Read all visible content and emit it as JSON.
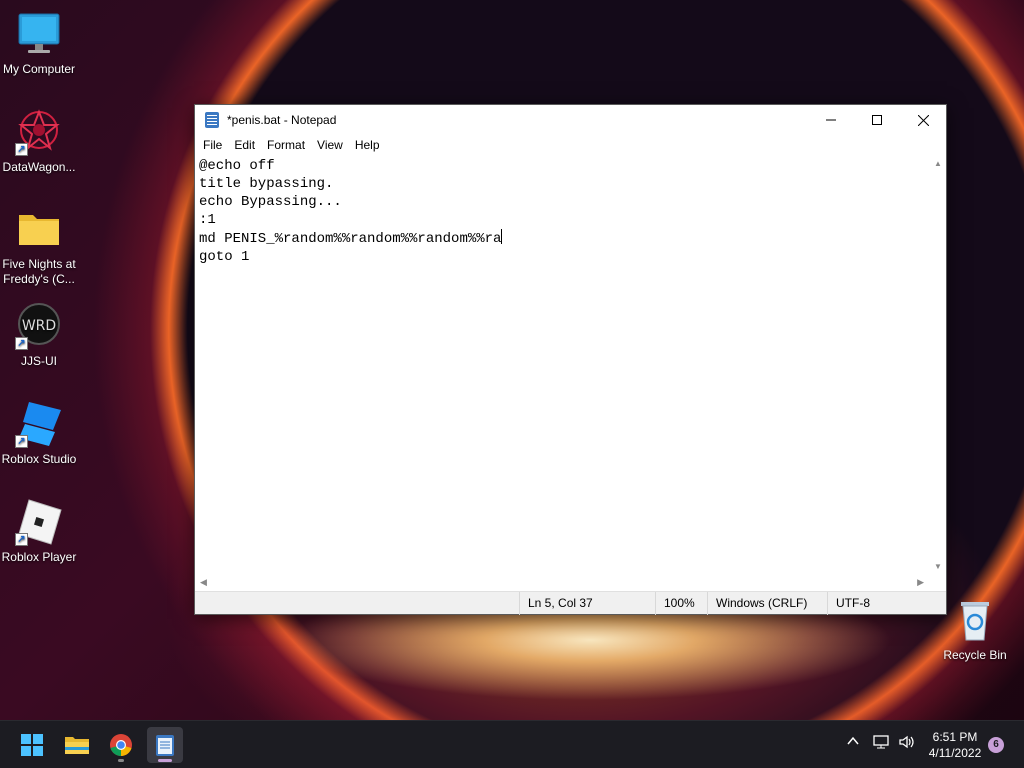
{
  "desktop": {
    "icons": [
      {
        "label": "My Computer"
      },
      {
        "label": "DataWagon..."
      },
      {
        "label": "Five Nights at Freddy's (C..."
      },
      {
        "label": "JJS-UI"
      },
      {
        "label": "Roblox Studio"
      },
      {
        "label": "Roblox Player"
      },
      {
        "label": "Recycle Bin"
      }
    ],
    "icon_logo_text": "WRD"
  },
  "notepad": {
    "title": "*penis.bat - Notepad",
    "menu": [
      "File",
      "Edit",
      "Format",
      "View",
      "Help"
    ],
    "lines": [
      "@echo off",
      "title bypassing.",
      "echo Bypassing...",
      ":1",
      "md PENIS_%random%%random%%random%%ra",
      "goto 1"
    ],
    "status": {
      "position": "Ln 5, Col 37",
      "zoom": "100%",
      "line_ending": "Windows (CRLF)",
      "encoding": "UTF-8"
    }
  },
  "taskbar": {
    "time": "6:51 PM",
    "date": "4/11/2022",
    "notification_count": "6"
  },
  "colors": {
    "accent": "#c8a0d8",
    "notepad_icon": "#3b78c2"
  }
}
